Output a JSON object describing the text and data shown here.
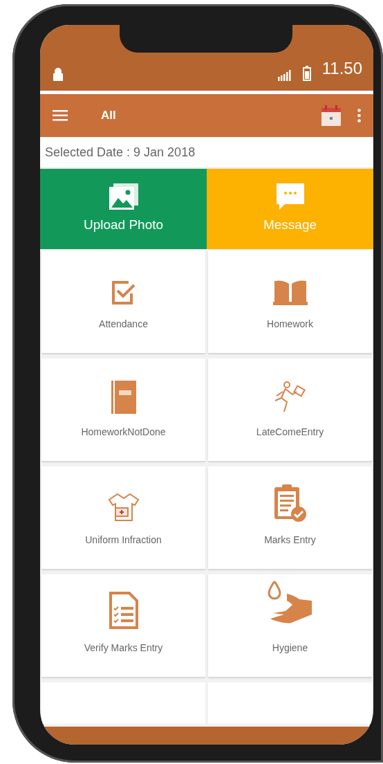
{
  "status_bar": {
    "time": "11.50"
  },
  "app_bar": {
    "title": "All"
  },
  "selected_date": "Selected Date : 9 Jan 2018",
  "actions": [
    {
      "label": "Upload Photo",
      "kind": "photo",
      "color": "#12995a"
    },
    {
      "label": "Message",
      "kind": "message",
      "color": "#fdb100"
    }
  ],
  "modules": [
    {
      "label": "Attendance",
      "kind": "checkbox"
    },
    {
      "label": "Homework",
      "kind": "book"
    },
    {
      "label": "HomeworkNotDone",
      "kind": "notebook"
    },
    {
      "label": "LateComeEntry",
      "kind": "runner"
    },
    {
      "label": "Uniform Infraction",
      "kind": "shirt"
    },
    {
      "label": "Marks Entry",
      "kind": "clipboard"
    },
    {
      "label": "Verify Marks Entry",
      "kind": "checklist"
    },
    {
      "label": "Hygiene",
      "kind": "hand"
    }
  ]
}
